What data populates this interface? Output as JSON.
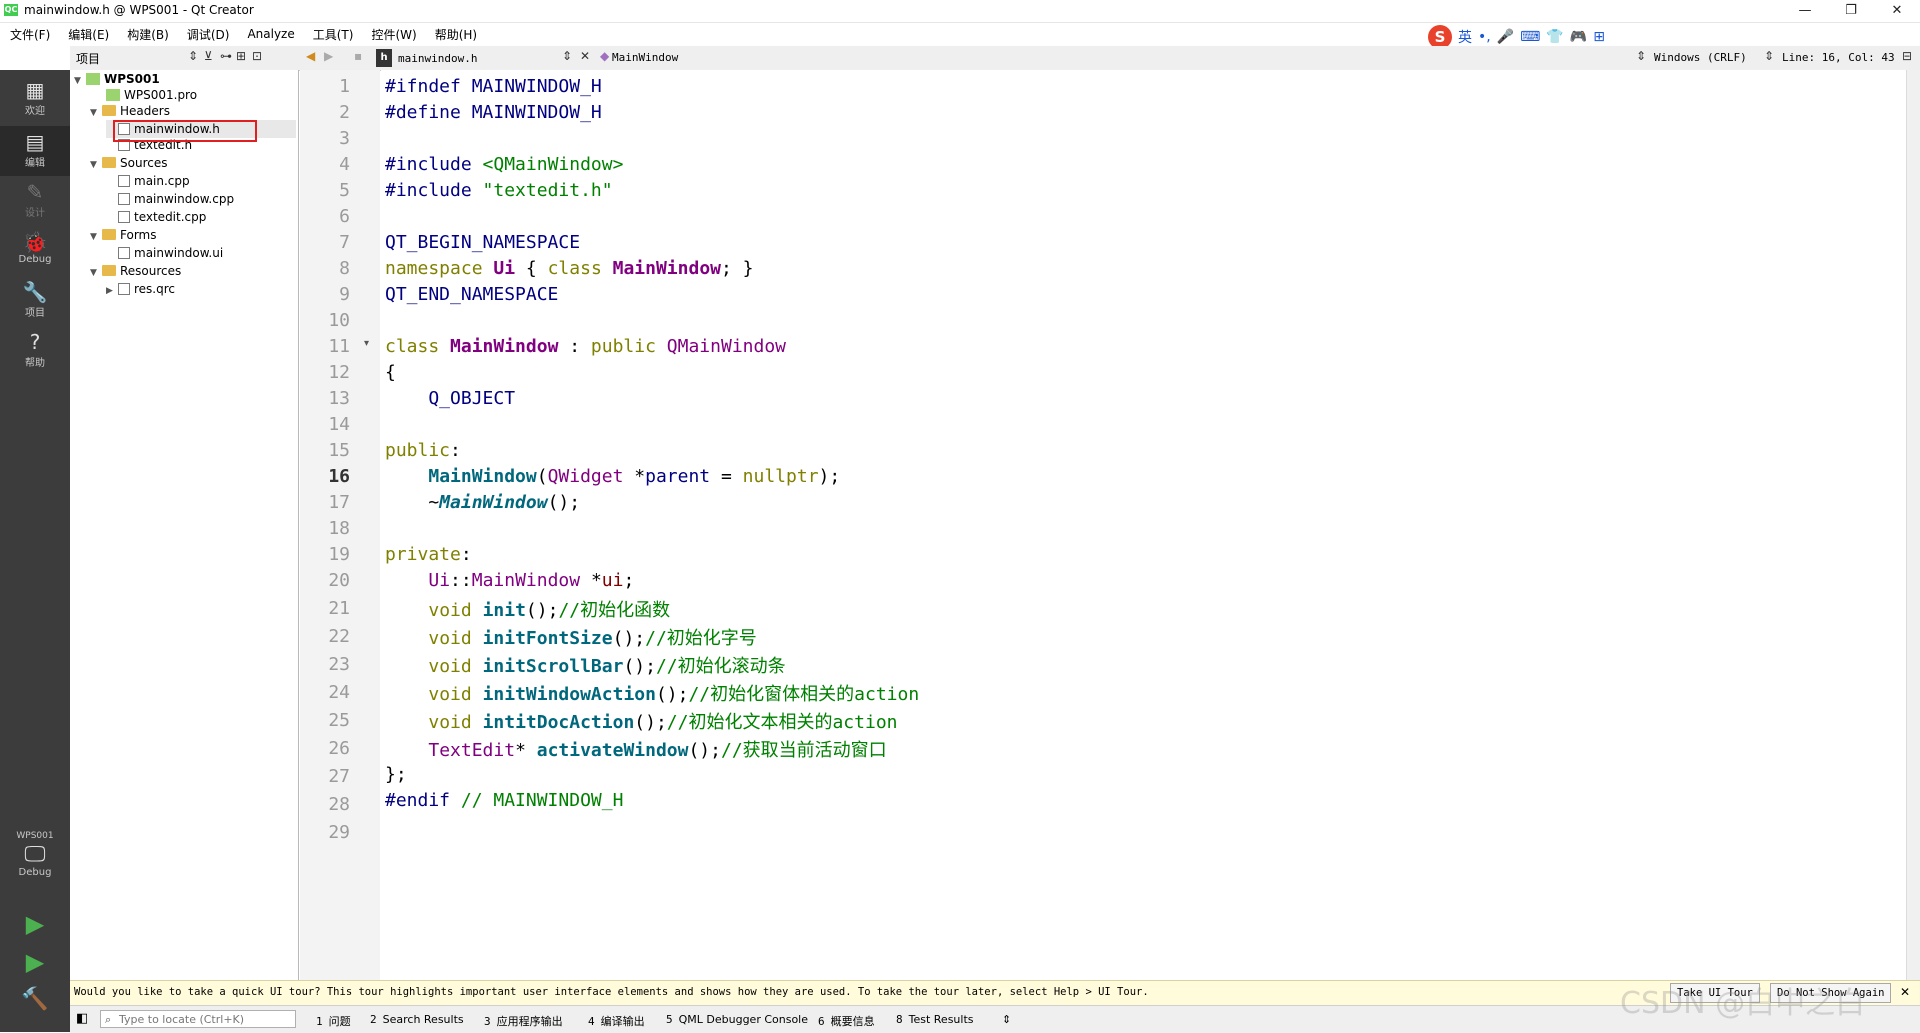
{
  "window": {
    "title": "mainwindow.h @ WPS001 - Qt Creator",
    "app_icon_text": "QC",
    "controls": {
      "minimize": "—",
      "maximize": "❐",
      "close": "✕"
    }
  },
  "ime": {
    "logo": "S",
    "items": [
      "英",
      "•,",
      "🎤",
      "⌨",
      "👕",
      "🎮",
      "⊞"
    ]
  },
  "menu": [
    "文件(F)",
    "编辑(E)",
    "构建(B)",
    "调试(D)",
    "Analyze",
    "工具(T)",
    "控件(W)",
    "帮助(H)"
  ],
  "toolbar": {
    "projects_label": "项目",
    "file_name": "mainwindow.h",
    "symbol": "MainWindow",
    "line_ending": "Windows (CRLF)",
    "cursor_pos": "Line: 16, Col: 43"
  },
  "modes": [
    {
      "label": "欢迎",
      "icon": "grid-icon",
      "glyph": "▦"
    },
    {
      "label": "编辑",
      "icon": "edit-icon",
      "glyph": "▤"
    },
    {
      "label": "设计",
      "icon": "pencil-icon",
      "glyph": "✎"
    },
    {
      "label": "Debug",
      "icon": "bug-icon",
      "glyph": "🐞"
    },
    {
      "label": "项目",
      "icon": "wrench-icon",
      "glyph": "🔧"
    },
    {
      "label": "帮助",
      "icon": "help-icon",
      "glyph": "?"
    }
  ],
  "kit": {
    "project": "WPS001",
    "mode": "Debug"
  },
  "tree": {
    "root": "WPS001",
    "pro": "WPS001.pro",
    "headers": "Headers",
    "header_files": [
      "mainwindow.h",
      "textedit.h"
    ],
    "sources": "Sources",
    "source_files": [
      "main.cpp",
      "mainwindow.cpp",
      "textedit.cpp"
    ],
    "forms": "Forms",
    "form_files": [
      "mainwindow.ui"
    ],
    "resources": "Resources",
    "resource_files": [
      "res.qrc"
    ]
  },
  "editor": {
    "current_line": 16,
    "line_numbers": [
      "1",
      "2",
      "3",
      "4",
      "5",
      "6",
      "7",
      "8",
      "9",
      "10",
      "11",
      "12",
      "13",
      "14",
      "15",
      "16",
      "17",
      "18",
      "19",
      "20",
      "21",
      "22",
      "23",
      "24",
      "25",
      "26",
      "27",
      "28",
      "29"
    ],
    "code": {
      "l1": [
        "#ifndef MAINWINDOW_H"
      ],
      "l2": [
        "#define MAINWINDOW_H"
      ],
      "l4": [
        "#include ",
        "<QMainWindow>"
      ],
      "l5": [
        "#include ",
        "\"textedit.h\""
      ],
      "l7": [
        "QT_BEGIN_NAMESPACE"
      ],
      "l8": [
        "namespace",
        " ",
        "Ui",
        " { ",
        "class",
        " ",
        "MainWindow",
        "; }"
      ],
      "l9": [
        "QT_END_NAMESPACE"
      ],
      "l11": [
        "class",
        " ",
        "MainWindow",
        " : ",
        "public",
        " ",
        "QMainWindow"
      ],
      "l12": [
        "{"
      ],
      "l13": [
        "    Q_OBJECT"
      ],
      "l15": [
        "public",
        ":"
      ],
      "l16": [
        "    ",
        "MainWindow",
        "(",
        "QWidget",
        " *",
        "parent",
        " = ",
        "nullptr",
        ");"
      ],
      "l17": [
        "    ~",
        "MainWindow",
        "();"
      ],
      "l19": [
        "private",
        ":"
      ],
      "l20": [
        "    ",
        "Ui",
        "::",
        "MainWindow",
        " *",
        "ui",
        ";"
      ],
      "l21": [
        "    ",
        "void",
        " ",
        "init",
        "();",
        "//初始化函数"
      ],
      "l22": [
        "    ",
        "void",
        " ",
        "initFontSize",
        "();",
        "//初始化字号"
      ],
      "l23": [
        "    ",
        "void",
        " ",
        "initScrollBar",
        "();",
        "//初始化滚动条"
      ],
      "l24": [
        "    ",
        "void",
        " ",
        "initWindowAction",
        "();",
        "//初始化窗体相关的action"
      ],
      "l25": [
        "    ",
        "void",
        " ",
        "intitDocAction",
        "();",
        "//初始化文本相关的action"
      ],
      "l26": [
        "    ",
        "TextEdit",
        "* ",
        "activateWindow",
        "();",
        "//获取当前活动窗口"
      ],
      "l27": [
        "};"
      ],
      "l28": [
        "#endif ",
        "// MAINWINDOW_H"
      ]
    }
  },
  "infobar": {
    "message": "Would you like to take a quick UI tour? This tour highlights important user interface elements and shows how they are used. To take the tour later, select Help > UI Tour.",
    "take_tour": "Take UI Tour",
    "dont_show": "Do Not Show Again"
  },
  "statusbar": {
    "locate_placeholder": "Type to locate (Ctrl+K)",
    "panes": [
      {
        "n": "1",
        "label": "问题"
      },
      {
        "n": "2",
        "label": "Search Results"
      },
      {
        "n": "3",
        "label": "应用程序输出"
      },
      {
        "n": "4",
        "label": "编译输出"
      },
      {
        "n": "5",
        "label": "QML Debugger Console"
      },
      {
        "n": "6",
        "label": "概要信息"
      },
      {
        "n": "8",
        "label": "Test Results"
      }
    ]
  },
  "watermark": "CSDN @白中之白"
}
